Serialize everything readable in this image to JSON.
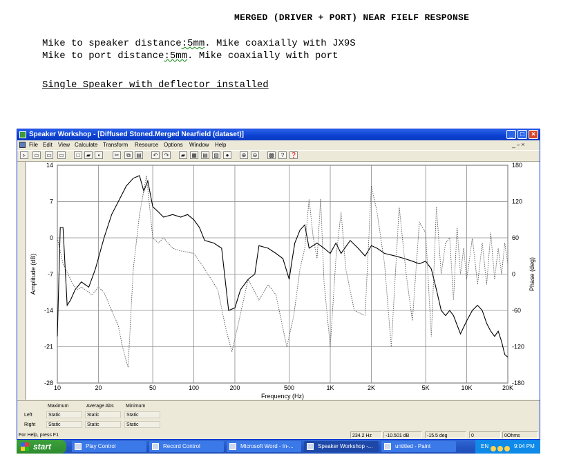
{
  "document": {
    "title": "MERGED (DRIVER + PORT) NEAR FIELF RESPONSE",
    "line1_a": "Mike to speaker distance",
    "line1_squig": ":5mm",
    "line1_b": ". Mike coaxially with JX9S",
    "line2_a": "Mike to port distance",
    "line2_squig": ":5mm",
    "line2_b": ". Mike coaxially with port",
    "subtitle": "Single Speaker with deflector installed"
  },
  "window": {
    "title": "Speaker Workshop - [Diffused Stoned.Merged Nearfield (dataset)]",
    "menu": [
      "File",
      "Edit",
      "View",
      "Calculate",
      "Transform",
      "Resource",
      "Options",
      "Window",
      "Help"
    ],
    "mdi_controls": "_  ▫  ×"
  },
  "toolbar": {
    "icons": [
      "select-tool-icon",
      "view-1-icon",
      "view-2-icon",
      "view-3-icon",
      "new-file-icon",
      "open-folder-icon",
      "save-icon",
      "cut-icon",
      "copy-icon",
      "paste-icon",
      "undo-icon",
      "redo-icon",
      "folder-icon",
      "grid-icon",
      "table-icon",
      "chart-icon",
      "record-icon",
      "zoom-in-icon",
      "zoom-out-icon",
      "print-icon",
      "help-icon",
      "context-help-icon"
    ]
  },
  "chart_data": {
    "type": "line",
    "xlabel": "Frequency (Hz)",
    "ylabel": "Amplitude (dB)",
    "y2label": "Phase (deg)",
    "x_scale": "log",
    "xlim": [
      10,
      20000
    ],
    "ylim": [
      -28,
      14
    ],
    "y2lim": [
      -180,
      180
    ],
    "grid": true,
    "x_ticks": [
      "10",
      "20",
      "50",
      "100",
      "200",
      "500",
      "1K",
      "2K",
      "5K",
      "10K",
      "20K"
    ],
    "x_tick_values": [
      10,
      20,
      50,
      100,
      200,
      500,
      1000,
      2000,
      5000,
      10000,
      20000
    ],
    "y_ticks": [
      "14",
      "7",
      "0",
      "-7",
      "-14",
      "-21",
      "-28"
    ],
    "y_tick_values": [
      14,
      7,
      0,
      -7,
      -14,
      -21,
      -28
    ],
    "y2_ticks": [
      "180",
      "120",
      "60",
      "0",
      "-60",
      "-120",
      "-180"
    ],
    "y2_tick_values": [
      180,
      120,
      60,
      0,
      -60,
      -120,
      -180
    ],
    "series": [
      {
        "style": "solid",
        "color": "#000000",
        "x": [
          10,
          10.5,
          11,
          11.8,
          12.5,
          13.5,
          15,
          17,
          19,
          22,
          25,
          28,
          32,
          36,
          40,
          43,
          46,
          50,
          55,
          60,
          70,
          80,
          90,
          100,
          110,
          120,
          140,
          160,
          180,
          200,
          220,
          250,
          280,
          300,
          350,
          400,
          450,
          500,
          520,
          550,
          600,
          650,
          700,
          800,
          900,
          1000,
          1100,
          1200,
          1400,
          1600,
          1800,
          2000,
          2200,
          2500,
          3000,
          3500,
          4000,
          4500,
          5000,
          5500,
          6000,
          6500,
          7000,
          7500,
          8000,
          9000,
          10000,
          11000,
          12000,
          13000,
          14000,
          15000,
          16000,
          17000,
          18000,
          19000,
          20000
        ],
        "values": [
          -19,
          2,
          2,
          -13,
          -12,
          -10,
          -8.5,
          -9.5,
          -6,
          0,
          4.5,
          7,
          10,
          11.5,
          12,
          9,
          11,
          6,
          5,
          4,
          4.5,
          4,
          4.5,
          3.5,
          2,
          -0.5,
          -1,
          -2,
          -14,
          -13.5,
          -10,
          -8,
          -7,
          -1.5,
          -2,
          -3,
          -4,
          -8,
          -5,
          -1,
          1.5,
          2.5,
          -2,
          -1,
          -2,
          -3,
          -1,
          -3,
          -0.5,
          -2,
          -3.5,
          -1.5,
          -2,
          -3,
          -3.5,
          -4,
          -4.5,
          -5,
          -4.5,
          -6,
          -10,
          -14,
          -15,
          -14,
          -15,
          -18.5,
          -16,
          -14,
          -13,
          -14,
          -16.5,
          -18,
          -19,
          -18,
          -20,
          -22.5,
          -23
        ]
      },
      {
        "style": "dotted",
        "color": "#555555",
        "x": [
          10,
          11,
          12,
          13,
          14,
          15,
          16,
          18,
          20,
          22,
          25,
          28,
          30,
          33,
          36,
          40,
          45,
          50,
          55,
          60,
          70,
          80,
          100,
          120,
          150,
          170,
          190,
          210,
          250,
          300,
          350,
          400,
          480,
          540,
          600,
          650,
          700,
          750,
          800,
          850,
          900,
          1000,
          1100,
          1200,
          1300,
          1500,
          1800,
          2000,
          2200,
          2500,
          2800,
          3200,
          3600,
          4000,
          4500,
          5000,
          5500,
          6000,
          6500,
          7000,
          7500,
          8000,
          8500,
          9000,
          9500,
          10000,
          11000,
          12000,
          13000,
          14000,
          15000,
          16000,
          17000,
          18000,
          19000,
          20000
        ],
        "values": [
          0,
          -5,
          -7,
          -9,
          -10,
          -9.5,
          -10,
          -11,
          -9.5,
          -10.5,
          -14,
          -17,
          -21,
          -25,
          -6,
          4.5,
          12,
          0,
          -1,
          0,
          -2,
          -2.5,
          -3,
          -6,
          -10,
          -17,
          -22,
          -17,
          -8,
          -12,
          -9,
          -11,
          -21,
          -15,
          -6,
          -2,
          7.5,
          0,
          -4,
          7.5,
          -8.5,
          -21,
          -4,
          5,
          -6,
          -14,
          -15,
          10,
          5,
          -5,
          -21,
          6,
          -7,
          -16,
          3,
          1,
          -19,
          6,
          -7,
          -1,
          0,
          -12,
          2,
          -7,
          -2,
          -8,
          0,
          -9,
          -1,
          -9,
          1,
          -8,
          -2,
          -7,
          -1,
          -5
        ]
      }
    ]
  },
  "stats": {
    "headers": [
      "Maximum",
      "Average Abs",
      "Minimum"
    ],
    "rows": [
      {
        "label": "Left",
        "values": [
          "Static",
          "Static",
          "Static"
        ]
      },
      {
        "label": "Right",
        "values": [
          "Static",
          "Static",
          "Static"
        ]
      }
    ]
  },
  "status": {
    "help": "For Help, press F1",
    "freq": "234.2 Hz",
    "db": "-10.501 dB",
    "deg": "-15.5 deg",
    "zero": "0",
    "ohms": "0Ohms"
  },
  "taskbar": {
    "start": "start",
    "tasks": [
      "Play Control",
      "Record Control",
      "Microsoft Word - In-...",
      "Speaker Workshop -...",
      "untitled - Paint"
    ],
    "lang": "EN",
    "clock": "9:04 PM"
  }
}
